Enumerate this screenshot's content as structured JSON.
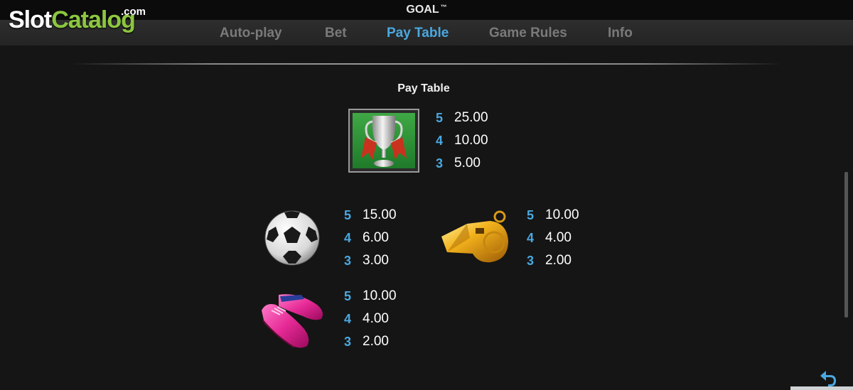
{
  "header": {
    "title": "GOAL",
    "trademark": "™"
  },
  "logo": {
    "slot": "Slot",
    "catalog": "Catalog",
    "com": ".com"
  },
  "tabs": [
    {
      "label": "Auto-play",
      "active": false
    },
    {
      "label": "Bet",
      "active": false
    },
    {
      "label": "Pay Table",
      "active": true
    },
    {
      "label": "Game Rules",
      "active": false
    },
    {
      "label": "Info",
      "active": false
    }
  ],
  "paytable": {
    "title": "Pay Table",
    "symbols": [
      {
        "name": "trophy",
        "pays": [
          {
            "count": "5",
            "value": "25.00"
          },
          {
            "count": "4",
            "value": "10.00"
          },
          {
            "count": "3",
            "value": "5.00"
          }
        ]
      },
      {
        "name": "soccer-ball",
        "pays": [
          {
            "count": "5",
            "value": "15.00"
          },
          {
            "count": "4",
            "value": "6.00"
          },
          {
            "count": "3",
            "value": "3.00"
          }
        ]
      },
      {
        "name": "whistle",
        "pays": [
          {
            "count": "5",
            "value": "10.00"
          },
          {
            "count": "4",
            "value": "4.00"
          },
          {
            "count": "3",
            "value": "2.00"
          }
        ]
      },
      {
        "name": "boots",
        "pays": [
          {
            "count": "5",
            "value": "10.00"
          },
          {
            "count": "4",
            "value": "4.00"
          },
          {
            "count": "3",
            "value": "2.00"
          }
        ]
      }
    ]
  },
  "colors": {
    "accent": "#4aa8e0",
    "background": "#151515",
    "logo_green": "#8cc63f"
  },
  "icons": {
    "back": "back-arrow-icon"
  }
}
